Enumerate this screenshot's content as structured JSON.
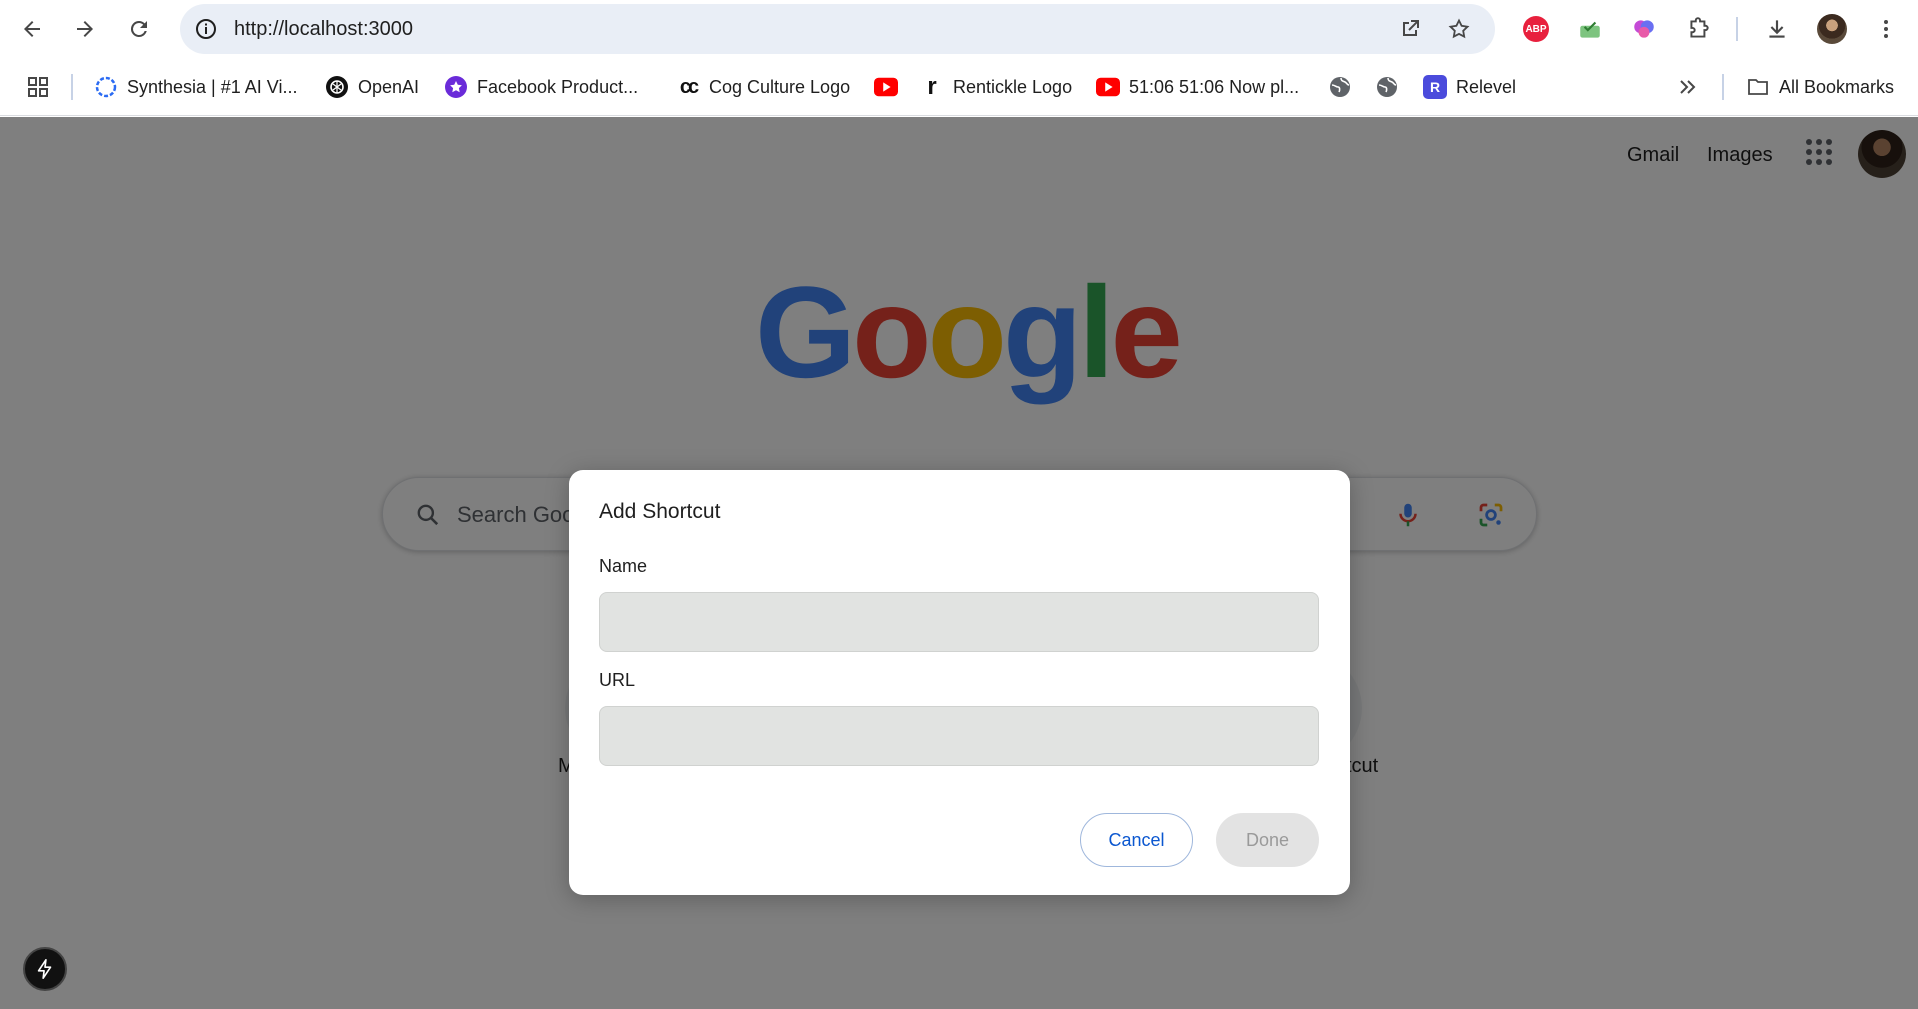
{
  "browser": {
    "url": "http://localhost:3000",
    "extensions": {
      "abp_label": "ABP"
    }
  },
  "bookmarks": [
    {
      "label": "Synthesia | #1 AI Vi..."
    },
    {
      "label": "OpenAI"
    },
    {
      "label": "Facebook Product..."
    },
    {
      "label": "Cog Culture Logo"
    },
    {
      "label": "Rentickle Logo"
    },
    {
      "label": "51:06 51:06 Now pl..."
    },
    {
      "label": "Relevel"
    },
    {
      "label": "All Bookmarks"
    }
  ],
  "bookmark_icons": {
    "relevel_letter": "R",
    "cog_culture_text": "cc",
    "rentickle_letter": "r"
  },
  "page": {
    "top_links": {
      "gmail": "Gmail",
      "images": "Images"
    },
    "logo": [
      "G",
      "o",
      "o",
      "g",
      "l",
      "e"
    ],
    "search_placeholder": "Search Google or type a URL",
    "shortcut_labels": {
      "left": "M",
      "right": "tcut"
    }
  },
  "dialog": {
    "title": "Add Shortcut",
    "name_label": "Name",
    "name_value": "",
    "url_label": "URL",
    "url_value": "",
    "cancel_label": "Cancel",
    "done_label": "Done"
  },
  "colors": {
    "google_blue": "#4285f4",
    "google_red": "#ea4335",
    "google_yellow": "#fbbc05",
    "google_green": "#34a853",
    "cancel_text": "#0b57d0",
    "input_bg": "#e1e3e1",
    "done_bg": "#e3e3e3"
  }
}
